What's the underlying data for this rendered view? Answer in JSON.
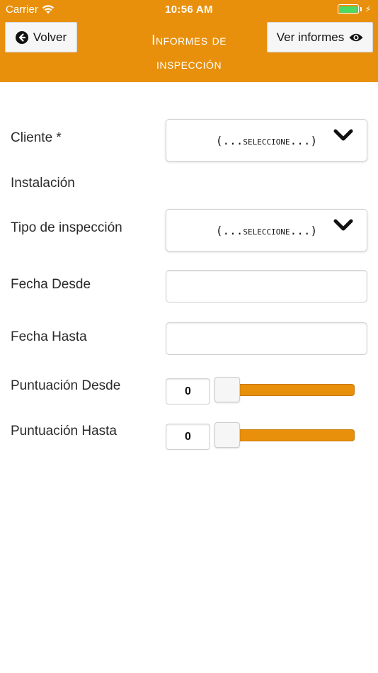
{
  "status_bar": {
    "carrier": "Carrier",
    "time": "10:56 AM"
  },
  "header": {
    "back_label": "Volver",
    "title_line1": "Informes de",
    "title_line2": "inspección",
    "view_label": "Ver informes",
    "background_color": "#e8900c"
  },
  "form": {
    "cliente": {
      "label": "Cliente *",
      "select_prefix": "(...",
      "select_value": "seleccione",
      "select_suffix": "...)"
    },
    "instalacion": {
      "label": "Instalación"
    },
    "tipo_inspeccion": {
      "label": "Tipo de inspección",
      "select_prefix": "(...",
      "select_value": "seleccione",
      "select_suffix": "...)"
    },
    "fecha_desde": {
      "label": "Fecha Desde",
      "value": ""
    },
    "fecha_hasta": {
      "label": "Fecha Hasta",
      "value": ""
    },
    "puntuacion_desde": {
      "label": "Puntuación Desde",
      "value": "0",
      "slider_fraction": 0
    },
    "puntuacion_hasta": {
      "label": "Puntuación Hasta",
      "value": "0",
      "slider_fraction": 0
    }
  },
  "icons": {
    "wifi": "wifi-icon",
    "battery": "battery-icon",
    "back": "arrow-left-circle-icon",
    "view": "eye-icon",
    "dropdown": "chevron-down-icon"
  },
  "accent_color": "#e8900c"
}
